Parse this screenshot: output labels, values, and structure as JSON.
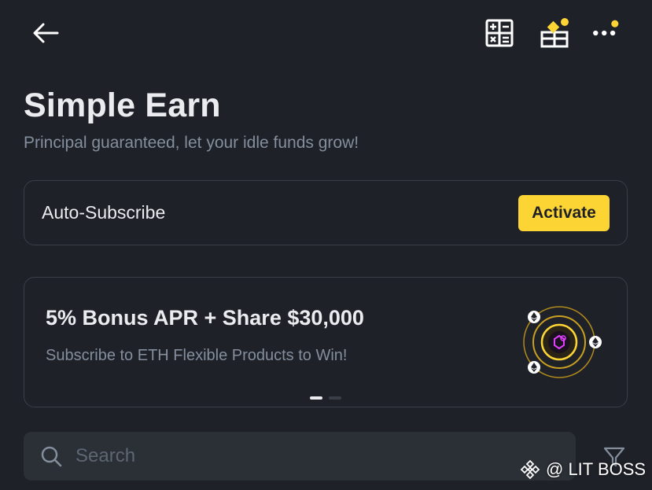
{
  "header": {
    "back_icon": "arrow-left-icon",
    "calculator_icon": "calculator-icon",
    "rewards_icon": "gift-icon",
    "more_icon": "more-dots-icon",
    "notification_color": "#fcd535"
  },
  "page": {
    "title": "Simple Earn",
    "subtitle": "Principal guaranteed, let your idle funds grow!"
  },
  "auto_subscribe": {
    "label": "Auto-Subscribe",
    "button_label": "Activate"
  },
  "promo": {
    "title": "5% Bonus APR + Share $30,000",
    "subtitle": "Subscribe to ETH Flexible Products to Win!",
    "carousel_total": 2,
    "carousel_active": 1
  },
  "search": {
    "placeholder": "Search",
    "value": ""
  },
  "filter": {
    "icon": "filter-icon"
  },
  "watermark": {
    "text": "@ LIT BOSS"
  },
  "colors": {
    "background": "#1f2129",
    "accent": "#fcd535",
    "card_border": "#3a3e48",
    "muted_text": "#848e9c",
    "primary_text": "#eaecef"
  }
}
